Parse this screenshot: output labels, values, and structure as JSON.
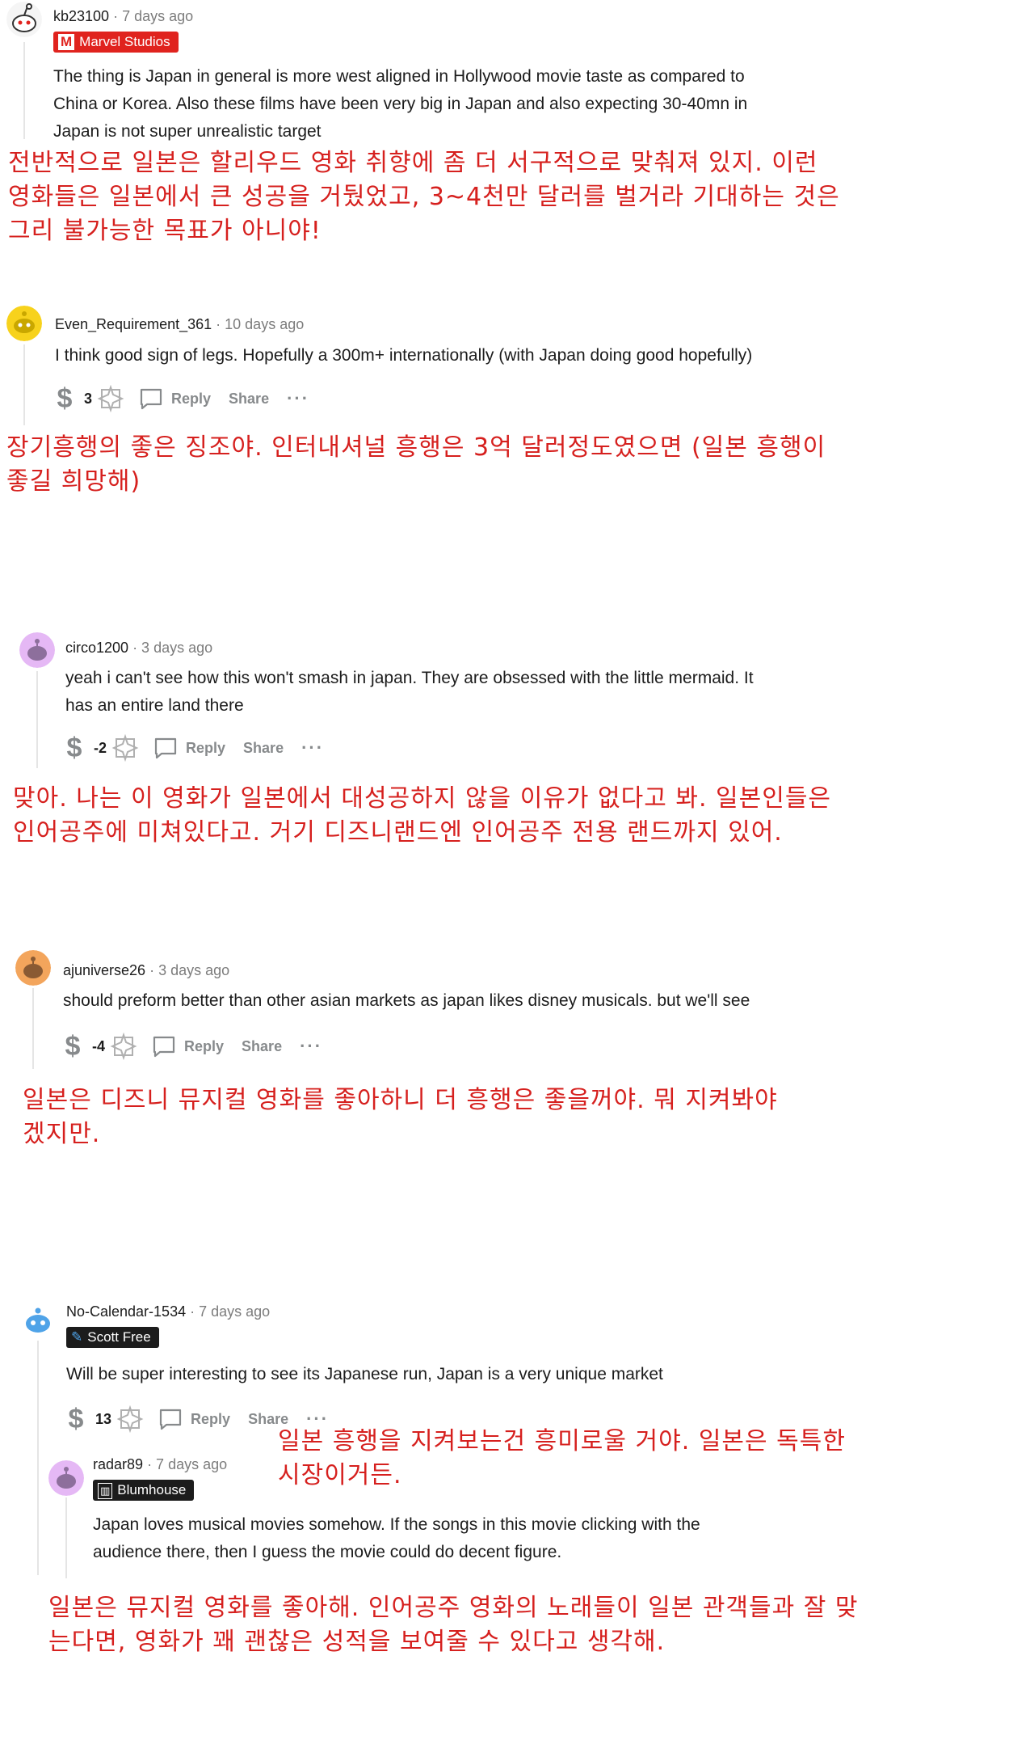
{
  "comments": [
    {
      "username": "kb23100",
      "time": "· 7 days ago",
      "flair": "Marvel Studios",
      "body": [
        "The thing is Japan in general is more west aligned in Hollywood movie taste as compared to",
        "China or Korea. Also these films have been very big in Japan and also expecting 30-40mn in",
        "Japan is not super unrealistic target"
      ],
      "translation": [
        "전반적으로 일본은 할리우드 영화 취향에 좀 더 서구적으로 맞춰져 있지. 이런",
        "영화들은 일본에서 큰 성공을 거뒀었고, 3~4천만 달러를 벌거라 기대하는 것은",
        "그리 불가능한 목표가 아니야!"
      ]
    },
    {
      "username": "Even_Requirement_361",
      "time": "· 10 days ago",
      "body": [
        "I think good sign of legs. Hopefully a 300m+ internationally (with Japan doing good hopefully)"
      ],
      "score": "3",
      "reply": "Reply",
      "share": "Share",
      "more": "···",
      "translation": [
        "장기흥행의 좋은 징조야. 인터내셔널 흥행은 3억 달러정도였으면 (일본 흥행이",
        "좋길 희망해)"
      ]
    },
    {
      "username": "circo1200",
      "time": "· 3 days ago",
      "body": [
        "yeah i can't see how this won't smash in japan. They are obsessed with the little mermaid. It",
        "has an entire land there"
      ],
      "score": "-2",
      "reply": "Reply",
      "share": "Share",
      "more": "···",
      "translation": [
        "맞아. 나는 이 영화가 일본에서 대성공하지 않을 이유가 없다고 봐. 일본인들은",
        "인어공주에 미쳐있다고. 거기 디즈니랜드엔 인어공주 전용 랜드까지 있어."
      ]
    },
    {
      "username": "ajuniverse26",
      "time": "· 3 days ago",
      "body": [
        "should preform better than other asian markets as japan likes disney musicals. but we'll see"
      ],
      "score": "-4",
      "reply": "Reply",
      "share": "Share",
      "more": "···",
      "translation": [
        "일본은 디즈니 뮤지컬 영화를 좋아하니 더 흥행은 좋을꺼야. 뭐 지켜봐야",
        "겠지만."
      ]
    },
    {
      "username": "No-Calendar-1534",
      "time": "· 7 days ago",
      "flair": "Scott Free",
      "body": [
        "Will be super interesting to see its Japanese run, Japan is a very unique market"
      ],
      "score": "13",
      "reply": "Reply",
      "share": "Share",
      "more": "···",
      "translation": [
        "일본 흥행을 지켜보는건 흥미로울 거야. 일본은 독특한",
        "시장이거든."
      ]
    },
    {
      "username": "radar89",
      "time": "· 7 days ago",
      "flair": "Blumhouse",
      "body": [
        "Japan loves musical movies somehow. If the songs in this movie clicking with the",
        "audience there, then I guess the movie could do decent figure."
      ],
      "translation": [
        "일본은 뮤지컬 영화를 좋아해. 인어공주 영화의 노래들이 일본 관객들과 잘 맞",
        "는다면, 영화가 꽤 괜찮은 성적을 보여줄 수 있다고 생각해."
      ]
    }
  ],
  "colors": {
    "translation": "#d6201e",
    "marvel_flair": "#e0231e",
    "dark_flair": "#1c1c1c",
    "meta": "#7c7c7c"
  }
}
